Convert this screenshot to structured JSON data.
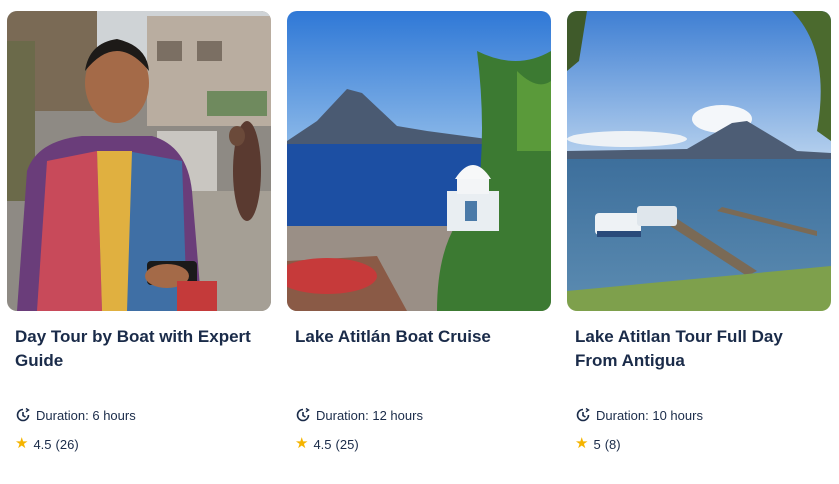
{
  "cards": [
    {
      "title": "Day Tour by Boat with Expert Guide",
      "duration": "Duration: 6 hours",
      "rating": "4.5",
      "reviews": "(26)"
    },
    {
      "title": "Lake Atitlán Boat Cruise",
      "duration": "Duration: 12 hours",
      "rating": "4.5",
      "reviews": "(25)"
    },
    {
      "title": "Lake Atitlan Tour Full Day From Antigua",
      "duration": "Duration: 10 hours",
      "rating": "5",
      "reviews": "(8)"
    }
  ],
  "icons": {
    "duration": "clock-icon",
    "rating": "star-icon"
  },
  "colors": {
    "text": "#1a2b49",
    "star": "#f5b400"
  }
}
